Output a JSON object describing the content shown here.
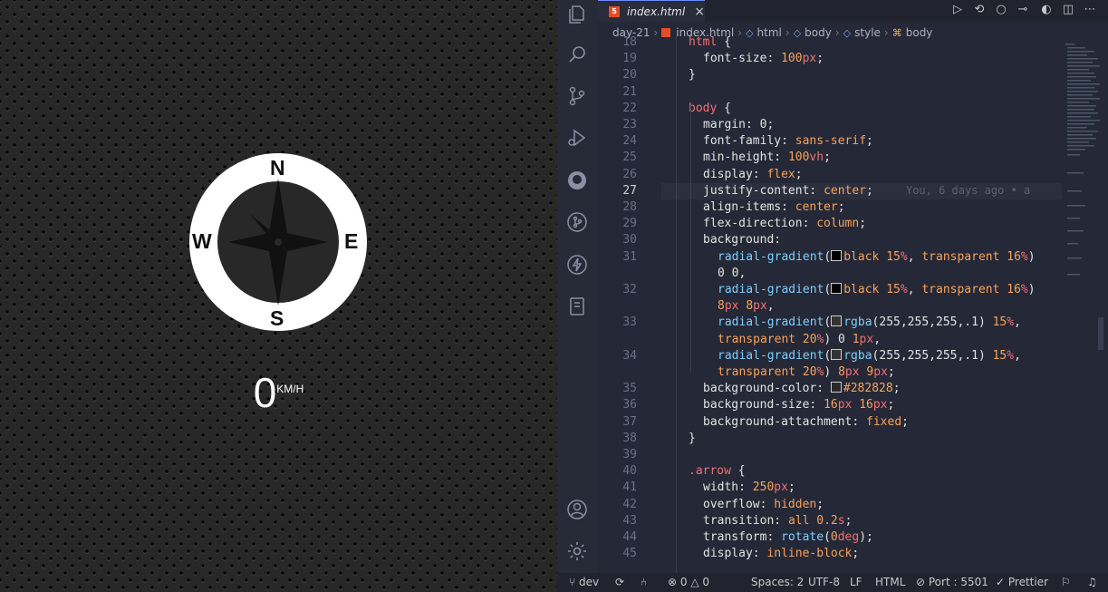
{
  "preview": {
    "compass": {
      "north": "N",
      "south": "S",
      "east": "E",
      "west": "W"
    },
    "speed": {
      "value": "0",
      "unit": "KM/H"
    }
  },
  "tab": {
    "filename": "index.html",
    "close": "×"
  },
  "breadcrumb": [
    "day-21",
    "index.html",
    "html",
    "body",
    "style",
    "body"
  ],
  "editor": {
    "active_line": "27",
    "blame": "You, 6 days ago • a",
    "lines": [
      {
        "n": "18",
        "code": "html {"
      },
      {
        "n": "19",
        "code": "font-size: 100px;"
      },
      {
        "n": "20",
        "code": "}"
      },
      {
        "n": "21",
        "code": ""
      },
      {
        "n": "22",
        "code": "body {"
      },
      {
        "n": "23",
        "code": "margin: 0;"
      },
      {
        "n": "24",
        "code": "font-family: sans-serif;"
      },
      {
        "n": "25",
        "code": "min-height: 100vh;"
      },
      {
        "n": "26",
        "code": "display: flex;"
      },
      {
        "n": "27",
        "code": "justify-content: center;"
      },
      {
        "n": "28",
        "code": "align-items: center;"
      },
      {
        "n": "29",
        "code": "flex-direction: column;"
      },
      {
        "n": "30",
        "code": "background:"
      },
      {
        "n": "31",
        "code": "radial-gradient(black 15%, transparent 16%)",
        "cont": "0 0,"
      },
      {
        "n": "32",
        "code": "radial-gradient(black 15%, transparent 16%)",
        "cont": "8px 8px,"
      },
      {
        "n": "33",
        "code": "radial-gradient(rgba(255,255,255,.1) 15%,",
        "cont": "transparent 20%) 0 1px,"
      },
      {
        "n": "34",
        "code": "radial-gradient(rgba(255,255,255,.1) 15%,",
        "cont": "transparent 20%) 8px 9px;"
      },
      {
        "n": "35",
        "code": "background-color: #282828;"
      },
      {
        "n": "36",
        "code": "background-size: 16px 16px;"
      },
      {
        "n": "37",
        "code": "background-attachment: fixed;"
      },
      {
        "n": "38",
        "code": "}"
      },
      {
        "n": "39",
        "code": ""
      },
      {
        "n": "40",
        "code": ".arrow {"
      },
      {
        "n": "41",
        "code": "width: 250px;"
      },
      {
        "n": "42",
        "code": "overflow: hidden;"
      },
      {
        "n": "43",
        "code": "transition: all 0.2s;"
      },
      {
        "n": "44",
        "code": "transform: rotate(0deg);"
      },
      {
        "n": "45",
        "code": "display: inline-block;"
      }
    ]
  },
  "statusbar": {
    "branch": "dev",
    "errors": "0",
    "warnings": "0",
    "spaces": "Spaces: 2",
    "encoding": "UTF-8",
    "eol": "LF",
    "language": "HTML",
    "port": "Port : 5501",
    "prettier": "Prettier"
  },
  "icons": {
    "activity": [
      "files-icon",
      "search-icon",
      "source-control-icon",
      "run-debug-icon",
      "github-icon",
      "git-graph-icon",
      "thunder-icon",
      "notebook-icon",
      "account-icon",
      "settings-icon"
    ]
  }
}
